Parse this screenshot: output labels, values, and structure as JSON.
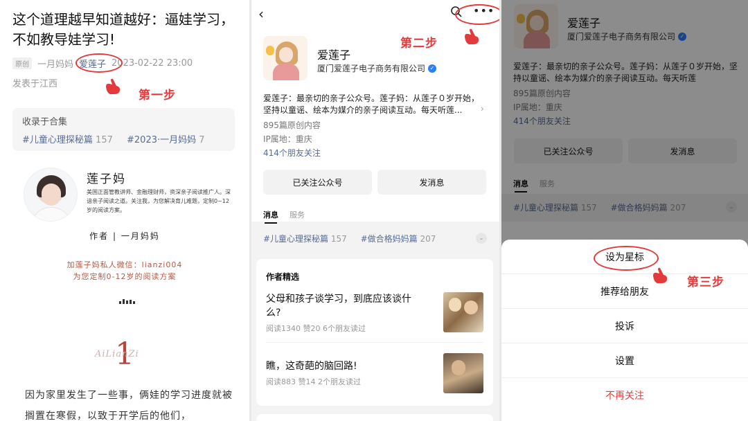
{
  "panel1": {
    "article_title": "这个道理越早知道越好：逼娃学习，不如教导娃学习!",
    "original_tag": "原创",
    "author_short": "一月妈妈",
    "account_link": "爱莲子",
    "date": "2023-02-22 23:00",
    "location": "发表于江西",
    "collection": {
      "label": "收录于合集",
      "items": [
        {
          "name": "#儿童心理探秘篇",
          "count": "157"
        },
        {
          "name": "#2023·一月妈妈",
          "count": "7"
        }
      ]
    },
    "author_card": {
      "name": "莲子妈",
      "bio": "美国正面管教讲师、金融理财师，资深亲子阅读推广人。深谙亲子阅读之道。关注我，为您解决育儿难题，定制0~12岁的阅读方案。",
      "byline": "作者 | 一月妈妈"
    },
    "wechat_line1": "加莲子妈私人微信：lianzi004",
    "wechat_line2": "为您定制0-12岁的阅读方案",
    "section_number": "1",
    "section_script": "AiLianZi",
    "body_text": "因为家里发生了一些事，俩娃的学习进度就被搁置在寒假，以致于开学后的他们，",
    "step_label": "第一步"
  },
  "panel2": {
    "account": {
      "name": "爱莲子",
      "company": "厦门爱莲子电子商务有限公司",
      "desc": "爱莲子：最亲切的亲子公众号。莲子妈：从莲子０岁开始，坚持以童谣、绘本为媒介的亲子阅读互动。每天听莲...",
      "articles": "895篇原创内容",
      "ip": "IP属地：重庆",
      "friends": "414个朋友关注"
    },
    "buttons": {
      "followed": "已关注公众号",
      "message": "发消息"
    },
    "tabs": {
      "messages": "消息",
      "services": "服务"
    },
    "collections": [
      {
        "name": "#儿童心理探秘篇",
        "count": "157"
      },
      {
        "name": "#做合格妈妈篇",
        "count": "207"
      }
    ],
    "card_heading": "作者精选",
    "articles": [
      {
        "title": "父母和孩子谈学习，到底应该谈什么?",
        "meta": "阅读1340  赞20  6个朋友读过"
      },
      {
        "title": "瞧，这奇葩的脑回路!",
        "meta": "阅读883  赞14  2个朋友读过"
      }
    ],
    "step_label": "第二步"
  },
  "panel3": {
    "account": {
      "name": "爱莲子",
      "company": "厦门爱莲子电子商务有限公司",
      "desc": "爱莲子：最亲切的亲子公众号。莲子妈：从莲子０岁开始，坚持以童谣、绘本为媒介的亲子阅读互动。每天听莲",
      "articles": "895篇原创内容",
      "ip": "IP属地：重庆",
      "friends": "414个朋友关注"
    },
    "buttons": {
      "followed": "已关注公众号",
      "message": "发消息"
    },
    "tabs": {
      "messages": "消息",
      "services": "服务"
    },
    "collections": [
      {
        "name": "#儿童心理探秘篇",
        "count": "157"
      },
      {
        "name": "#做合格妈妈篇",
        "count": "207"
      }
    ],
    "sheet": {
      "star": "设为星标",
      "recommend": "推荐给朋友",
      "report": "投诉",
      "settings": "设置",
      "unfollow": "不再关注"
    },
    "step_label": "第三步"
  },
  "colors": {
    "annotation": "#e33b3b",
    "link": "#576b95",
    "verified": "#2d7ff9"
  }
}
